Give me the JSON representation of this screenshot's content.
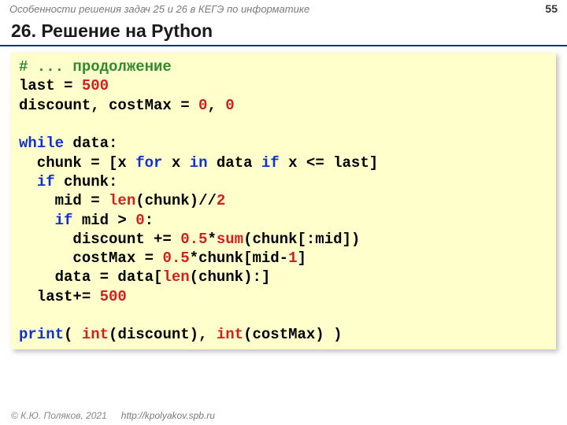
{
  "header": {
    "subject": "Особенности решения задач 25 и 26 в КЕГЭ по информатике",
    "page": "55"
  },
  "title": "26. Решение на Python",
  "code": {
    "comment": "# ... продолжение",
    "l2a": "last = ",
    "l2b": "500",
    "l3a": "discount, costMax = ",
    "l3b": "0",
    "l3c": ", ",
    "l3d": "0",
    "blank1": "",
    "l5a": "while",
    "l5b": " data:",
    "l6a": "  chunk = [x ",
    "l6b": "for",
    "l6c": " x ",
    "l6d": "in",
    "l6e": " data ",
    "l6f": "if",
    "l6g": " x <= last]",
    "l7a": "  ",
    "l7b": "if",
    "l7c": " chunk:",
    "l8a": "    mid = ",
    "l8b": "len",
    "l8c": "(chunk)//",
    "l8d": "2",
    "l9a": "    ",
    "l9b": "if",
    "l9c": " mid > ",
    "l9d": "0",
    "l9e": ":",
    "l10a": "      discount += ",
    "l10b": "0.5",
    "l10c": "*",
    "l10d": "sum",
    "l10e": "(chunk[:mid])",
    "l11a": "      costMax = ",
    "l11b": "0.5",
    "l11c": "*chunk[mid-",
    "l11d": "1",
    "l11e": "]",
    "l12a": "    data = data[",
    "l12b": "len",
    "l12c": "(chunk):]",
    "l13a": "  last+= ",
    "l13b": "500",
    "blank2": "",
    "l15a": "print",
    "l15b": "( ",
    "l15c": "int",
    "l15d": "(discount), ",
    "l15e": "int",
    "l15f": "(costMax) )"
  },
  "footer": {
    "copyright": "© К.Ю. Поляков, 2021",
    "url": "http://kpolyakov.spb.ru"
  }
}
